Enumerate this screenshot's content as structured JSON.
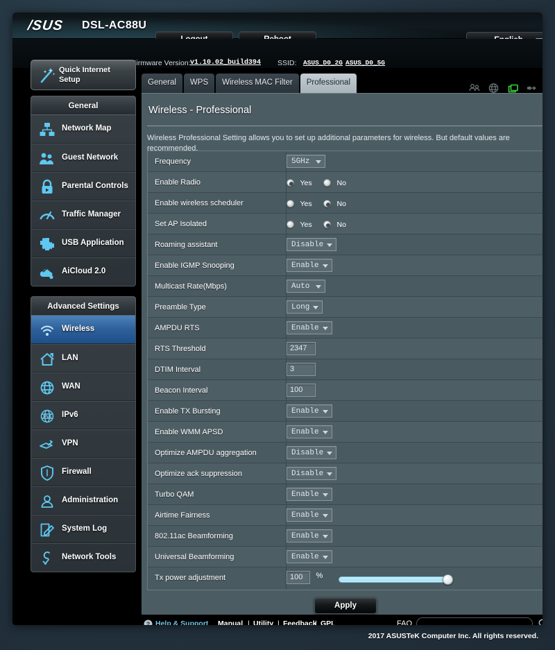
{
  "header": {
    "brand": "/SUS",
    "model": "DSL-AC88U",
    "logout_label": "Logout",
    "reboot_label": "Reboot",
    "language": "English",
    "firmware_label": "Firmware Version:",
    "firmware_version": "v1.10.02_build394",
    "ssid_label": "SSID:",
    "ssid_2g": "ASUS_D0_2G",
    "ssid_5g": "ASUS_D0_5G",
    "status_icons": [
      {
        "name": "clients-icon",
        "active": false
      },
      {
        "name": "globe-icon",
        "active": false
      },
      {
        "name": "connected-devices-icon",
        "active": true
      },
      {
        "name": "usb-icon",
        "active": false
      },
      {
        "name": "printer-icon",
        "active": false
      }
    ],
    "accent_active_color": "#3cd53c"
  },
  "quick_setup": {
    "label": "Quick Internet Setup",
    "icon": "magic-wand-icon"
  },
  "tabs": [
    {
      "label": "General",
      "active": false
    },
    {
      "label": "WPS",
      "active": false
    },
    {
      "label": "Wireless MAC Filter",
      "active": false
    },
    {
      "label": "Professional",
      "active": true
    }
  ],
  "sidebar": {
    "general_header": "General",
    "general_items": [
      {
        "label": "Network Map",
        "icon": "network-map-icon"
      },
      {
        "label": "Guest Network",
        "icon": "guest-network-icon"
      },
      {
        "label": "Parental Controls",
        "icon": "parental-controls-icon"
      },
      {
        "label": "Traffic Manager",
        "icon": "traffic-manager-icon"
      },
      {
        "label": "USB Application",
        "icon": "usb-application-icon"
      },
      {
        "label": "AiCloud 2.0",
        "icon": "aicloud-icon"
      }
    ],
    "advanced_header": "Advanced Settings",
    "advanced_items": [
      {
        "label": "Wireless",
        "icon": "wifi-icon",
        "selected": true
      },
      {
        "label": "LAN",
        "icon": "home-icon",
        "selected": false
      },
      {
        "label": "WAN",
        "icon": "globe-icon",
        "selected": false
      },
      {
        "label": "IPv6",
        "icon": "ipv6-icon",
        "selected": false
      },
      {
        "label": "VPN",
        "icon": "vpn-icon",
        "selected": false
      },
      {
        "label": "Firewall",
        "icon": "shield-icon",
        "selected": false
      },
      {
        "label": "Administration",
        "icon": "user-icon",
        "selected": false
      },
      {
        "label": "System Log",
        "icon": "log-icon",
        "selected": false
      },
      {
        "label": "Network Tools",
        "icon": "tools-icon",
        "selected": false
      }
    ],
    "selected_color": "#2f6099"
  },
  "main": {
    "title": "Wireless - Professional",
    "description": "Wireless Professional Setting allows you to set up additional parameters for wireless. But default values are recommended.",
    "rows": [
      {
        "label": "Frequency",
        "type": "select",
        "value": "5GHz"
      },
      {
        "label": "Enable Radio",
        "type": "radio",
        "yes_label": "Yes",
        "no_label": "No",
        "value": "Yes"
      },
      {
        "label": "Enable wireless scheduler",
        "type": "radio",
        "yes_label": "Yes",
        "no_label": "No",
        "value": "No"
      },
      {
        "label": "Set AP Isolated",
        "type": "radio",
        "yes_label": "Yes",
        "no_label": "No",
        "value": "No"
      },
      {
        "label": "Roaming assistant",
        "type": "select",
        "value": "Disable"
      },
      {
        "label": "Enable IGMP Snooping",
        "type": "select",
        "value": "Enable"
      },
      {
        "label": "Multicast Rate(Mbps)",
        "type": "select",
        "value": "Auto"
      },
      {
        "label": "Preamble Type",
        "type": "select",
        "value": "Long"
      },
      {
        "label": "AMPDU RTS",
        "type": "select",
        "value": "Enable"
      },
      {
        "label": "RTS Threshold",
        "type": "text",
        "value": "2347"
      },
      {
        "label": "DTIM Interval",
        "type": "text",
        "value": "3"
      },
      {
        "label": "Beacon Interval",
        "type": "text",
        "value": "100"
      },
      {
        "label": "Enable TX Bursting",
        "type": "select",
        "value": "Enable"
      },
      {
        "label": "Enable WMM APSD",
        "type": "select",
        "value": "Enable"
      },
      {
        "label": "Optimize AMPDU aggregation",
        "type": "select",
        "value": "Disable"
      },
      {
        "label": "Optimize ack suppression",
        "type": "select",
        "value": "Disable"
      },
      {
        "label": "Turbo QAM",
        "type": "select",
        "value": "Enable"
      },
      {
        "label": "Airtime Fairness",
        "type": "select",
        "value": "Enable"
      },
      {
        "label": "802.11ac Beamforming",
        "type": "select",
        "value": "Enable"
      },
      {
        "label": "Universal Beamforming",
        "type": "select",
        "value": "Enable"
      },
      {
        "label": "Tx power adjustment",
        "type": "slider",
        "value": "100",
        "unit": "%",
        "slider_percent": 100
      }
    ],
    "apply_label": "Apply"
  },
  "footer": {
    "help_label": "Help & Support",
    "links": [
      "Manual",
      "Utility",
      "Feedback",
      "GPL"
    ],
    "separator": "|",
    "faq_label": "FAQ",
    "faq_value": "",
    "copyright": "2017 ASUSTeK Computer Inc. All rights reserved."
  }
}
